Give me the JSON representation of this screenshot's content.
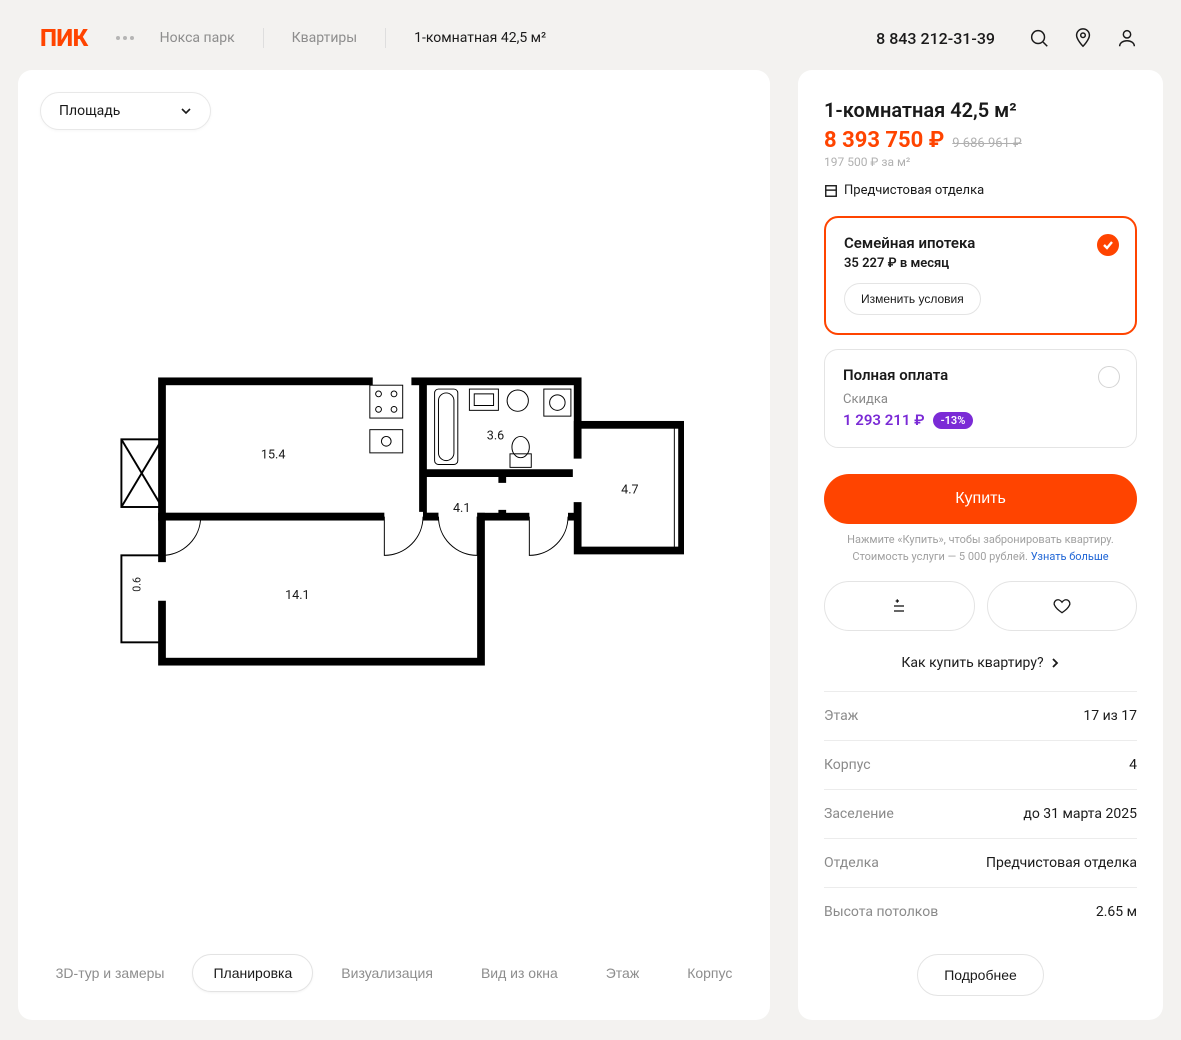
{
  "header": {
    "logo": "ПИК",
    "breadcrumbs": [
      "Нокса парк",
      "Квартиры",
      "1-комнатная 42,5 м²"
    ],
    "phone": "8 843 212-31-39"
  },
  "left": {
    "area_chip": "Площадь",
    "rooms": {
      "kitchen": "15.4",
      "living": "14.1",
      "bath": "3.6",
      "hall": "4.1",
      "loggia": "4.7",
      "balcony": "0.6"
    },
    "tabs": [
      "3D-тур и замеры",
      "Планировка",
      "Визуализация",
      "Вид из окна",
      "Этаж",
      "Корпус"
    ],
    "active_tab": 1
  },
  "side": {
    "title": "1-комнатная 42,5 м²",
    "price": "8 393 750 ₽",
    "price_old": "9 686 961 ₽",
    "price_per": "197 500 ₽ за м²",
    "finish": "Предчистовая отделка",
    "mortgage": {
      "title": "Семейная ипотека",
      "monthly": "35 227 ₽ в месяц",
      "change": "Изменить условия"
    },
    "fullpay": {
      "title": "Полная оплата",
      "discount_label": "Скидка",
      "discount": "1 293 211 ₽",
      "badge": "-13%"
    },
    "buy": "Купить",
    "buy_hint1": "Нажмите «Купить», чтобы забронировать квартиру.",
    "buy_hint2": "Стоимость услуги — 5 000 рублей.",
    "buy_hint_link": "Узнать больше",
    "howbuy": "Как купить квартиру?",
    "specs": [
      {
        "label": "Этаж",
        "value": "17 из 17"
      },
      {
        "label": "Корпус",
        "value": "4"
      },
      {
        "label": "Заселение",
        "value": "до 31 марта 2025"
      },
      {
        "label": "Отделка",
        "value": "Предчистовая отделка"
      },
      {
        "label": "Высота потолков",
        "value": "2.65 м"
      }
    ],
    "more": "Подробнее"
  }
}
